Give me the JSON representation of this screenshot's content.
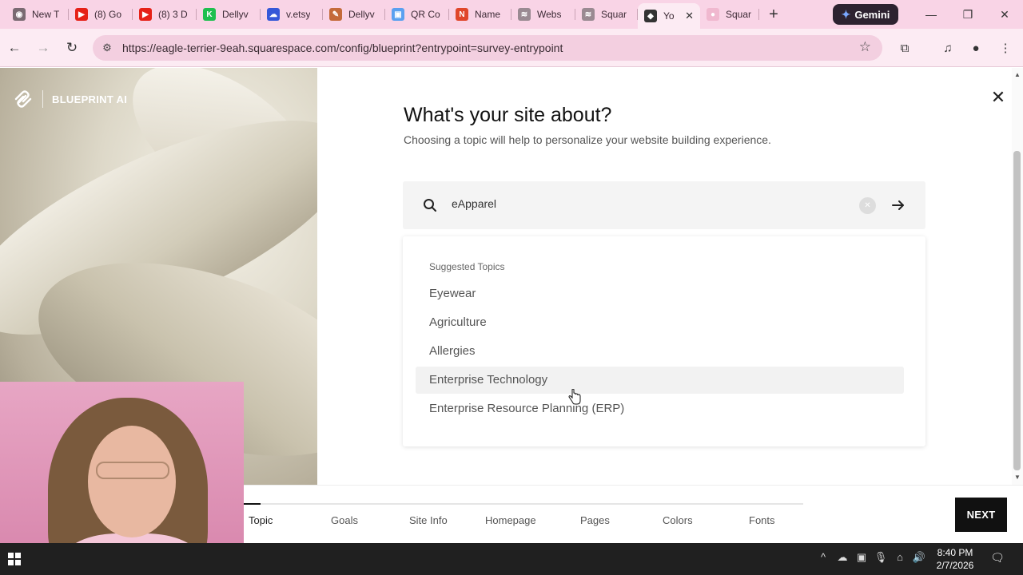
{
  "browser": {
    "tabs": [
      {
        "title": "New T",
        "color": "#7a6a72",
        "glyph": "◉"
      },
      {
        "title": "(8) Go",
        "color": "#e62117",
        "glyph": "▶"
      },
      {
        "title": "(8) 3 D",
        "color": "#e62117",
        "glyph": "▶"
      },
      {
        "title": "Dellyv",
        "color": "#1fbf4f",
        "glyph": "K"
      },
      {
        "title": "v.etsy",
        "color": "#3558d8",
        "glyph": "☁"
      },
      {
        "title": "Dellyv",
        "color": "#c46a3a",
        "glyph": "✎"
      },
      {
        "title": "QR Co",
        "color": "#5aa0f0",
        "glyph": "▣"
      },
      {
        "title": "Name",
        "color": "#e0462a",
        "glyph": "N"
      },
      {
        "title": "Webs",
        "color": "#9a8a92",
        "glyph": "≋"
      },
      {
        "title": "Squar",
        "color": "#9a8a92",
        "glyph": "≋"
      },
      {
        "title": "Yo",
        "color": "#333333",
        "glyph": "◆",
        "active": true
      },
      {
        "title": "Squar",
        "color": "#f0b8cf",
        "glyph": "●"
      }
    ],
    "gemini_label": "Gemini",
    "url": "https://eagle-terrier-9eah.squarespace.com/config/blueprint?entrypoint=survey-entrypoint"
  },
  "brand": {
    "name": "BLUEPRINT AI"
  },
  "survey": {
    "heading": "What's your site about?",
    "subheading": "Choosing a topic will help to personalize your website building experience.",
    "search_value": "eApparel",
    "suggestions_header": "Suggested Topics",
    "suggestions": [
      {
        "label": "Eyewear"
      },
      {
        "label": "Agriculture"
      },
      {
        "label": "Allergies"
      },
      {
        "label": "Enterprise Technology",
        "highlighted": true
      },
      {
        "label": "Enterprise Resource Planning (ERP)"
      }
    ]
  },
  "footer": {
    "progress": 0.03,
    "steps": [
      {
        "label": "Topic",
        "current": true
      },
      {
        "label": "Goals"
      },
      {
        "label": "Site Info"
      },
      {
        "label": "Homepage"
      },
      {
        "label": "Pages"
      },
      {
        "label": "Colors"
      },
      {
        "label": "Fonts"
      }
    ],
    "next_label": "NEXT"
  },
  "taskbar": {
    "time": "8:40 PM",
    "date": "2/7/2026"
  },
  "colors": {
    "tabstrip": "#f9d4e6",
    "toolbar": "#fcebf3",
    "next_button": "#111111"
  }
}
